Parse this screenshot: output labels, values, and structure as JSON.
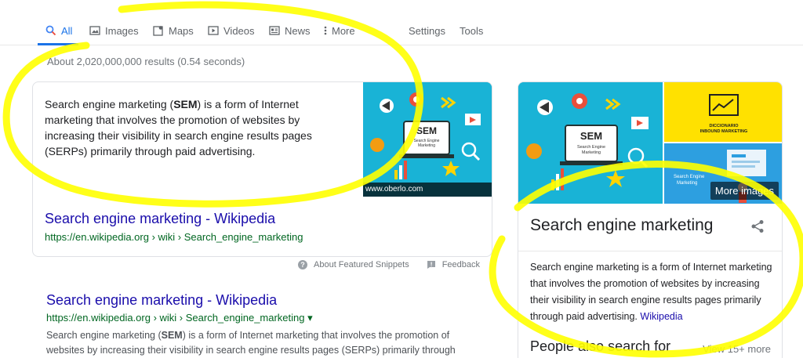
{
  "tabs": [
    {
      "label": "All",
      "icon": "search-icon"
    },
    {
      "label": "Images",
      "icon": "image-icon"
    },
    {
      "label": "Maps",
      "icon": "map-icon"
    },
    {
      "label": "Videos",
      "icon": "video-icon"
    },
    {
      "label": "News",
      "icon": "news-icon"
    },
    {
      "label": "More",
      "icon": "more-icon"
    }
  ],
  "tools": {
    "settings": "Settings",
    "tools": "Tools"
  },
  "result_stats": "About 2,020,000,000 results (0.54 seconds)",
  "featured_snippet": {
    "text_before": "Search engine marketing (",
    "text_bold": "SEM",
    "text_after": ") is a form of Internet marketing that involves the promotion of websites by increasing their visibility in search engine results pages (SERPs) primarily through paid advertising.",
    "image_caption": "www.oberlo.com",
    "image_label_title": "SEM",
    "image_label_sub": "Search Engine Marketing",
    "title": "Search engine marketing - Wikipedia",
    "url": "https://en.wikipedia.org › wiki › Search_engine_marketing"
  },
  "snippet_footer": {
    "about": "About Featured Snippets",
    "feedback": "Feedback"
  },
  "organic_result": {
    "title": "Search engine marketing - Wikipedia",
    "url": "https://en.wikipedia.org › wiki › Search_engine_marketing ▾",
    "desc_before": "Search engine marketing (",
    "desc_bold": "SEM",
    "desc_after": ") is a form of Internet marketing that involves the promotion of websites by increasing their visibility in search engine results pages (SERPs) primarily through"
  },
  "knowledge_panel": {
    "title": "Search engine marketing",
    "more_images": "More images",
    "yellow_image_text": "DICCIONARIO INBOUND MARKETING",
    "blue_image_text": "Search Engine Marketing",
    "description": "Search engine marketing is a form of Internet marketing that involves the promotion of websites by increasing their visibility in search engine results pages primarily through paid advertising.",
    "source_link": "Wikipedia",
    "people_also_search": "People also search for",
    "view_more": "View 15+ more"
  },
  "colors": {
    "link": "#1a0dab",
    "url": "#006621",
    "accent": "#1a73e8",
    "highlight": "#ffff00"
  }
}
